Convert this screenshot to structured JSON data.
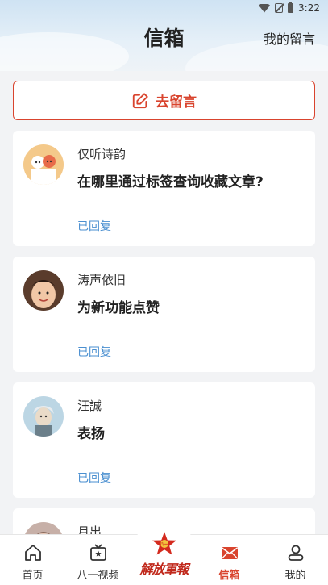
{
  "status_bar": {
    "time": "3:22"
  },
  "header": {
    "title": "信箱",
    "my_messages_link": "我的留言"
  },
  "compose_button": {
    "label": "去留言",
    "icon": "edit-icon"
  },
  "colors": {
    "accent": "#d9442e",
    "status_link": "#4a8fd0"
  },
  "messages": [
    {
      "author": "仅听诗韵",
      "subject": "在哪里通过标签查询收藏文章?",
      "status": "已回复"
    },
    {
      "author": "涛声依旧",
      "subject": "为新功能点赞",
      "status": "已回复"
    },
    {
      "author": "汪誠",
      "subject": "表扬",
      "status": "已回复"
    },
    {
      "author": "月出"
    }
  ],
  "tabbar": {
    "items": [
      {
        "label": "首页",
        "icon": "home-icon"
      },
      {
        "label": "八一视频",
        "icon": "video-star-icon"
      },
      {
        "label": "解放軍報",
        "icon": "star-logo-icon"
      },
      {
        "label": "信箱",
        "icon": "mail-icon",
        "active": true
      },
      {
        "label": "我的",
        "icon": "user-icon"
      }
    ]
  }
}
